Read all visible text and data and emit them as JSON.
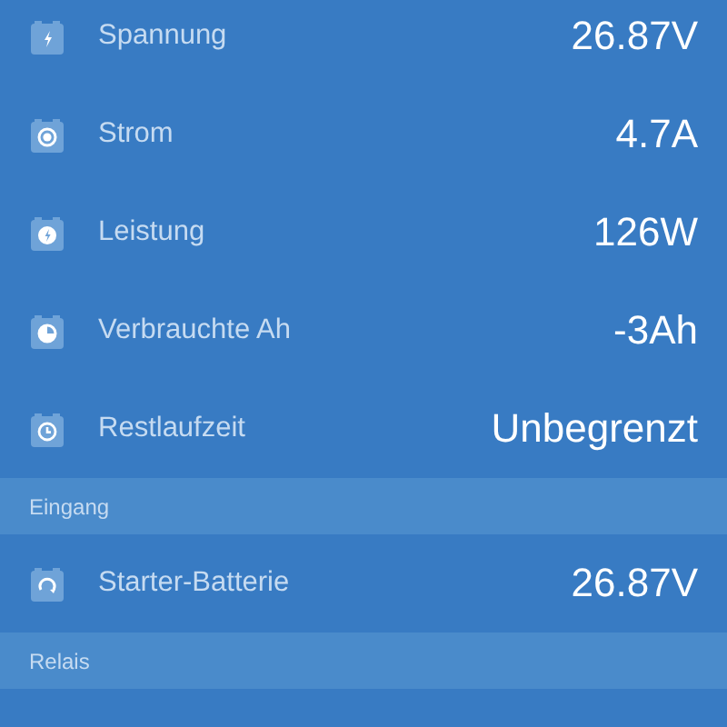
{
  "sections": [
    {
      "kind": "rows",
      "rows": [
        {
          "kind": "bolt",
          "label": "Spannung",
          "value": "26.87V"
        },
        {
          "kind": "dot",
          "label": "Strom",
          "value": "4.7A"
        },
        {
          "kind": "power",
          "label": "Leistung",
          "value": "126W"
        },
        {
          "kind": "consumed",
          "label": "Verbrauchte Ah",
          "value": "-3Ah"
        },
        {
          "kind": "clock",
          "label": "Restlaufzeit",
          "value": "Unbegrenzt"
        }
      ]
    },
    {
      "kind": "header",
      "title": "Eingang"
    },
    {
      "kind": "rows",
      "rows": [
        {
          "kind": "refresh",
          "label": "Starter-Batterie",
          "value": "26.87V"
        }
      ]
    },
    {
      "kind": "header",
      "title": "Relais"
    }
  ]
}
